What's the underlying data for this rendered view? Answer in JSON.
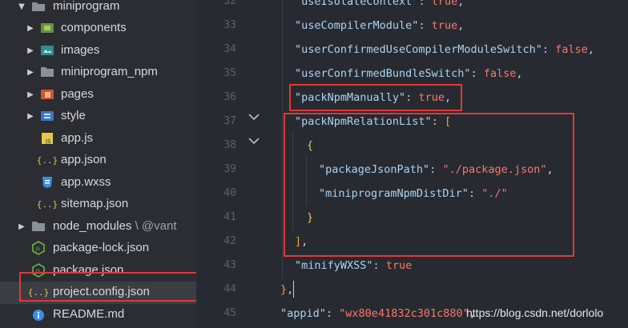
{
  "sidebar": {
    "items": [
      {
        "label": "miniprogram"
      },
      {
        "label": "components"
      },
      {
        "label": "images"
      },
      {
        "label": "miniprogram_npm"
      },
      {
        "label": "pages"
      },
      {
        "label": "style"
      },
      {
        "label": "app.js"
      },
      {
        "label": "app.json"
      },
      {
        "label": "app.wxss"
      },
      {
        "label": "sitemap.json"
      },
      {
        "label": "node_modules",
        "suffix": " \\ @vant"
      },
      {
        "label": "package-lock.json"
      },
      {
        "label": "package.json"
      },
      {
        "label": "project.config.json"
      },
      {
        "label": "README.md"
      }
    ]
  },
  "gutter": {
    "lines": [
      "32",
      "33",
      "34",
      "35",
      "36",
      "37",
      "38",
      "39",
      "40",
      "41",
      "42",
      "43",
      "44",
      "45"
    ]
  },
  "code": {
    "l32": {
      "key": "\"useIsolateContext\"",
      "colon": ": ",
      "val": "true",
      "end": ","
    },
    "l33": {
      "key": "\"useCompilerModule\"",
      "colon": ": ",
      "val": "true",
      "end": ","
    },
    "l34": {
      "key": "\"userConfirmedUseCompilerModuleSwitch\"",
      "colon": ": ",
      "val": "false",
      "end": ","
    },
    "l35": {
      "key": "\"userConfirmedBundleSwitch\"",
      "colon": ": ",
      "val": "false",
      "end": ","
    },
    "l36": {
      "key": "\"packNpmManually\"",
      "colon": ": ",
      "val": "true",
      "end": ","
    },
    "l37": {
      "key": "\"packNpmRelationList\"",
      "colon": ": ",
      "open": "["
    },
    "l38": {
      "open": "{"
    },
    "l39": {
      "key": "\"packageJsonPath\"",
      "colon": ": ",
      "val": "\"./package.json\"",
      "end": ","
    },
    "l40": {
      "key": "\"miniprogramNpmDistDir\"",
      "colon": ": ",
      "val": "\"./\""
    },
    "l41": {
      "close": "}"
    },
    "l42": {
      "close": "]",
      "end": ","
    },
    "l43": {
      "key": "\"minifyWXSS\"",
      "colon": ": ",
      "val": "true"
    },
    "l44": {
      "close": "}",
      "end": ","
    },
    "l45": {
      "key": "\"appid\"",
      "colon": ": ",
      "val": "\"wx80e41832c301c880\"",
      "end": ","
    }
  },
  "watermark": "https://blog.csdn.net/dorlolo",
  "colors": {
    "highlight": "#e2383a",
    "string": "#f47b6c",
    "key": "#a9d4f5",
    "bracket": "#f0a21d"
  }
}
